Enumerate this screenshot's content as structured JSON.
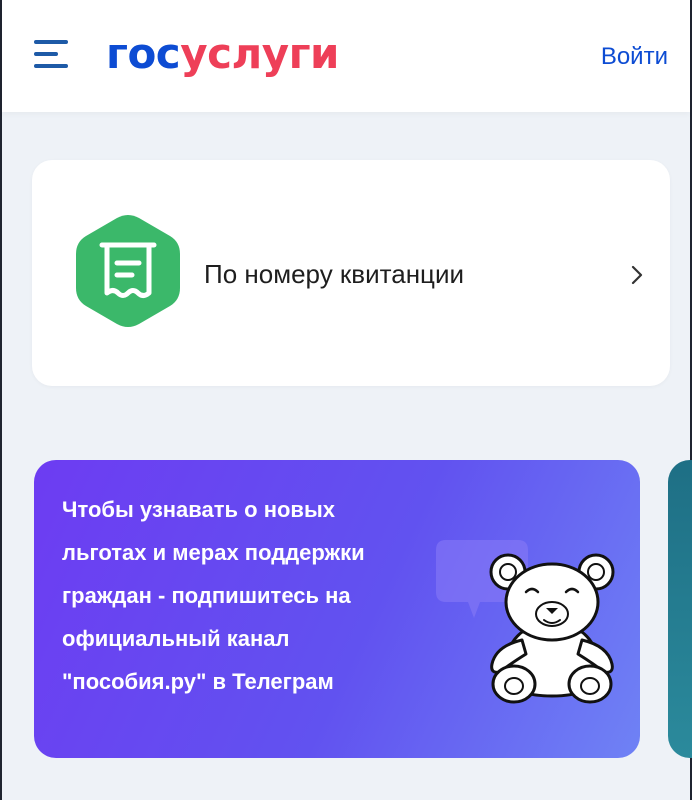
{
  "header": {
    "logo_part1": "гос",
    "logo_part2": "услуги",
    "login_label": "Войти",
    "menu_icon": "hamburger-menu-icon"
  },
  "receipt_card": {
    "label": "По номеру квитанции",
    "icon": "receipt-icon",
    "chevron_icon": "chevron-right-icon"
  },
  "promo": {
    "lines": [
      "Чтобы узнавать о новых",
      "льготах и мерах поддержки",
      "граждан - подпишитесь на",
      "официальный канал",
      "\"пособия.ру\" в Телеграм"
    ],
    "illustration": "teddy-bear-icon"
  },
  "colors": {
    "brand_blue": "#0d4cd3",
    "brand_red": "#ee3f58",
    "receipt_green": "#3bb86a",
    "promo_purple": "#6d3cf2",
    "background": "#eef2f7"
  }
}
